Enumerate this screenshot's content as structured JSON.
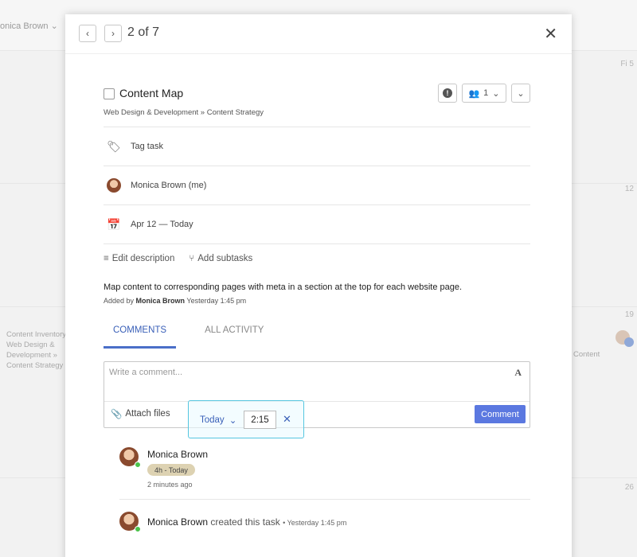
{
  "background": {
    "user_picker": "onica Brown",
    "day_numbers": [
      "Fi 5",
      "12",
      "19",
      "26"
    ],
    "left_card": "Content Inventory Web Design & Development » Content Strategy",
    "right_card": "Content"
  },
  "modal": {
    "counter": "2 of 7",
    "close_label": "✕"
  },
  "task": {
    "title": "Content Map",
    "breadcrumb": "Web Design & Development » Content Strategy",
    "assignee_count": "1",
    "tag_label": "Tag task",
    "assignee": "Monica Brown (me)",
    "dates": "Apr 12 — Today",
    "edit_description": "Edit description",
    "add_subtasks": "Add subtasks",
    "description": "Map content to corresponding pages with meta in a section at the top for each website page.",
    "added_prefix": "Added by",
    "added_by": "Monica Brown",
    "added_time": "Yesterday 1:45 pm"
  },
  "tabs": [
    {
      "label": "COMMENTS",
      "active": true
    },
    {
      "label": "ALL ACTIVITY",
      "active": false
    }
  ],
  "comment_box": {
    "placeholder": "Write a comment...",
    "format_icon": "A",
    "attach_label": "Attach files",
    "submit_label": "Comment"
  },
  "timer": {
    "day": "Today",
    "time": "2:15"
  },
  "activity": [
    {
      "name": "Monica Brown",
      "badge": "4h - Today",
      "time": "2 minutes ago"
    },
    {
      "name": "Monica Brown",
      "action": "created this task",
      "time": "Yesterday 1:45 pm"
    }
  ],
  "colors": {
    "accent": "#5b78e0",
    "tab_active": "#4a6fc8",
    "timer_outline": "#55c6e0",
    "online": "#4bc34b",
    "badge_bg": "#ddd2b2"
  }
}
